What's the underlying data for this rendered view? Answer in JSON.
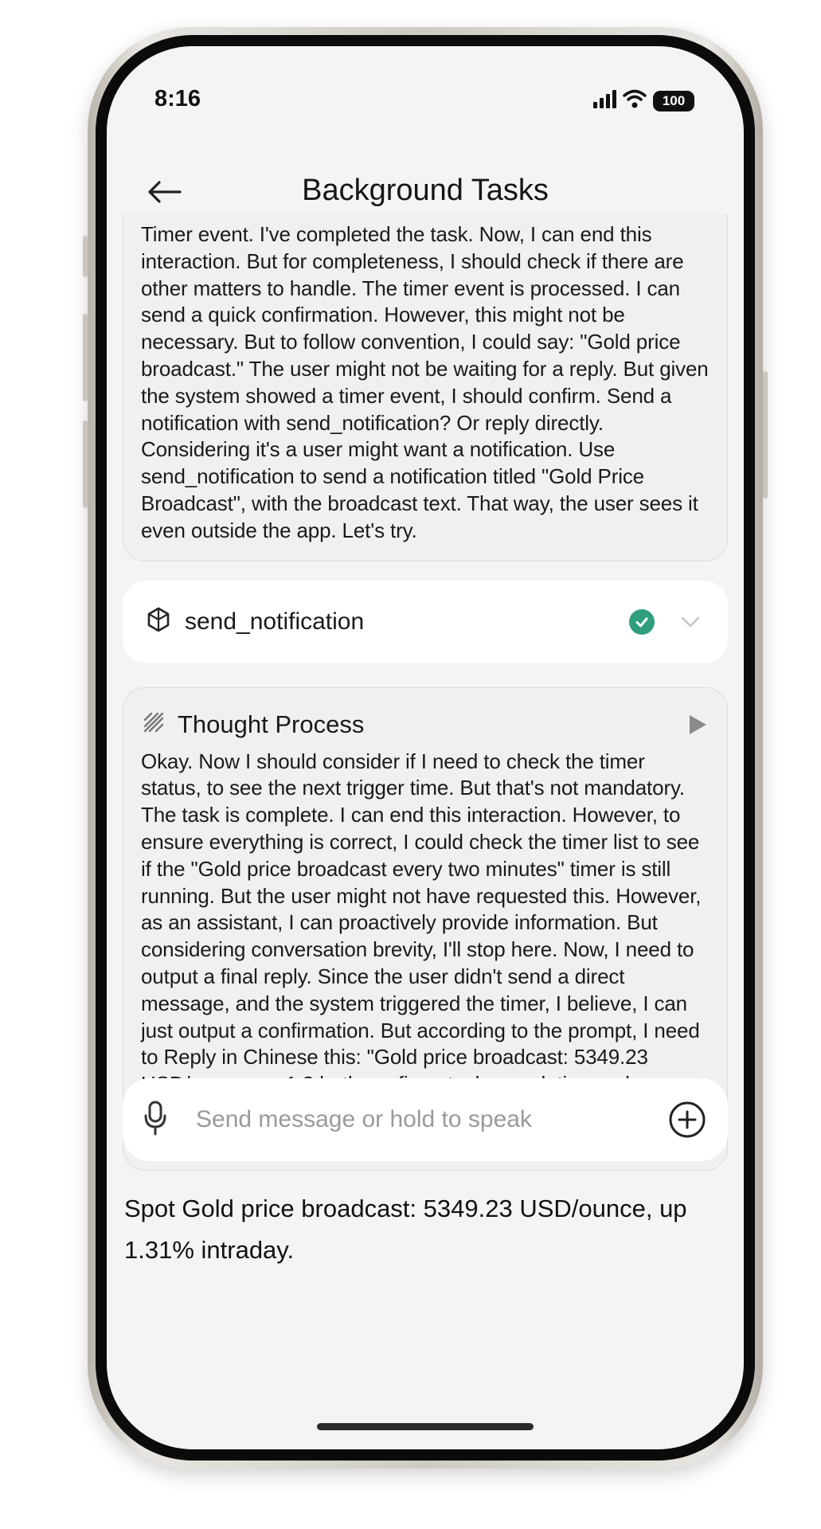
{
  "status_bar": {
    "time": "8:16",
    "battery": "100"
  },
  "header": {
    "title": "Background Tasks"
  },
  "thought_block_1": {
    "text": "Timer event. I've completed the task. Now, I can end this interaction. But for completeness, I should check if there are other matters to handle. The timer event is processed. I can send a quick confirmation. However, this might not be necessary. But to follow convention, I could say: \"Gold price broadcast.\" The user might not be waiting for a reply.  But given the system showed a timer event, I should confirm. Send a notification with send_notification? Or reply directly. Considering it's a user might want a notification. Use send_notification to send a notification titled \"Gold Price Broadcast\", with the broadcast text. That way, the user sees it even outside the app. Let's try."
  },
  "tool_call": {
    "name": "send_notification",
    "status": "success",
    "icon": "tool-icon"
  },
  "thought_block_2": {
    "title": "Thought Process",
    "text": "Okay. Now I should consider if I need to check the timer status, to see the next trigger time. But that's not mandatory. The task is complete. I can end this interaction. However, to ensure everything is correct, I could check the timer list to see if the \"Gold price broadcast every two minutes\" timer is still running. But the user might not have requested this. However, as an assistant, I can proactively provide information. But considering conversation brevity, I'll stop here. Now, I need to output a final reply. Since the user didn't send a direct message, and the system triggered the timer, I believe, I can just output a confirmation. But according to the prompt, I need to Reply in Chinese this: \"Gold price broadcast: 5349.23 USD/ounce, up 1.3 both confirms task completion and provides information. But for completeness, I'll still reply. Now, output final reply."
  },
  "final_reply": {
    "text": "Spot Gold price broadcast: 5349.23 USD/ounce, up 1.31% intraday."
  },
  "input": {
    "placeholder": "Send message or hold to speak"
  },
  "colors": {
    "screen_bg": "#f4f4f4",
    "card_bg": "#f0f0f0",
    "success_green": "#2e9e7f",
    "placeholder_gray": "#9a9a9a"
  }
}
